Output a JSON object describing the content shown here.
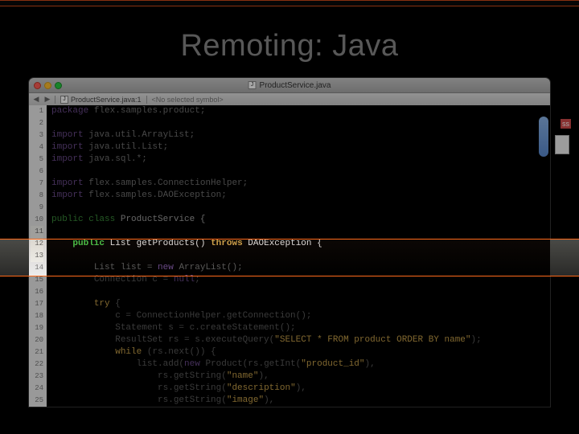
{
  "slide": {
    "title": "Remoting: Java"
  },
  "window": {
    "title": "ProductService.java",
    "breadcrumb_file": "ProductService.java:1",
    "breadcrumb_symbol": "<No selected symbol>"
  },
  "side": {
    "tag": "ss"
  },
  "page": {
    "left": "",
    "right": ""
  },
  "code": {
    "lines": [
      {
        "n": 1,
        "html": "<span class='kw-pkg'>package</span> <span class='hp'>flex.samples.product;</span>"
      },
      {
        "n": 2,
        "html": ""
      },
      {
        "n": 3,
        "html": "<span class='kw-imp'>import</span> <span class='hp'>java.util.ArrayList;</span>"
      },
      {
        "n": 4,
        "html": "<span class='kw-imp'>import</span> <span class='hp'>java.util.List;</span>"
      },
      {
        "n": 5,
        "html": "<span class='kw-imp'>import</span> <span class='hp'>java.sql.*;</span>"
      },
      {
        "n": 6,
        "html": ""
      },
      {
        "n": 7,
        "html": "<span class='kw-imp'>import</span> <span class='hp'>flex.samples.ConnectionHelper;</span>"
      },
      {
        "n": 8,
        "html": "<span class='kw-imp'>import</span> <span class='hp'>flex.samples.DAOException;</span>"
      },
      {
        "n": 9,
        "html": ""
      },
      {
        "n": 10,
        "html": "<span class='kw-pub'>public</span> <span class='kw-cls'>class</span> <span class='ident'>ProductService</span> <span class='ident'>{</span>"
      },
      {
        "n": 11,
        "html": "",
        "hl": true
      },
      {
        "n": 12,
        "html": "    <span class='kw-pub'>public</span> <span class='kw-type'>List</span> <span class='ident'>getProducts()</span> <span class='kw-throws'>throws</span> <span class='ident'>DAOException {</span>",
        "hl": true,
        "hlLine": true
      },
      {
        "n": 13,
        "html": "",
        "hl": true
      },
      {
        "n": 14,
        "html": "        <span class='dim'>List list = </span><span class='kw-new'>new</span> <span class='dim'>ArrayList();</span>"
      },
      {
        "n": 15,
        "html": "        <span class='dim'>Connection c = </span><span class='kw-new'>null</span><span class='dim'>;</span>"
      },
      {
        "n": 16,
        "html": ""
      },
      {
        "n": 17,
        "html": "        <span class='kw-try'>try</span> <span class='dim'>{</span>"
      },
      {
        "n": 18,
        "html": "            <span class='dim'>c = ConnectionHelper.getConnection();</span>"
      },
      {
        "n": 19,
        "html": "            <span class='dim'>Statement s = c.createStatement();</span>"
      },
      {
        "n": 20,
        "html": "            <span class='dim'>ResultSet rs = s.executeQuery(</span><span class='str'>\"SELECT * FROM product ORDER BY name\"</span><span class='dim'>);</span>"
      },
      {
        "n": 21,
        "html": "            <span class='kw-while'>while</span> <span class='dim'>(rs.next()) {</span>"
      },
      {
        "n": 22,
        "html": "                <span class='dim'>list.add(</span><span class='kw-new'>new</span> <span class='dim'>Product(rs.getInt(</span><span class='str'>\"product_id\"</span><span class='dim'>),</span>"
      },
      {
        "n": 23,
        "html": "                    <span class='dim'>rs.getString(</span><span class='str'>\"name\"</span><span class='dim'>),</span>"
      },
      {
        "n": 24,
        "html": "                    <span class='dim'>rs.getString(</span><span class='str'>\"description\"</span><span class='dim'>),</span>"
      },
      {
        "n": 25,
        "html": "                    <span class='dim'>rs.getString(</span><span class='str'>\"image\"</span><span class='dim'>),</span>"
      }
    ]
  }
}
